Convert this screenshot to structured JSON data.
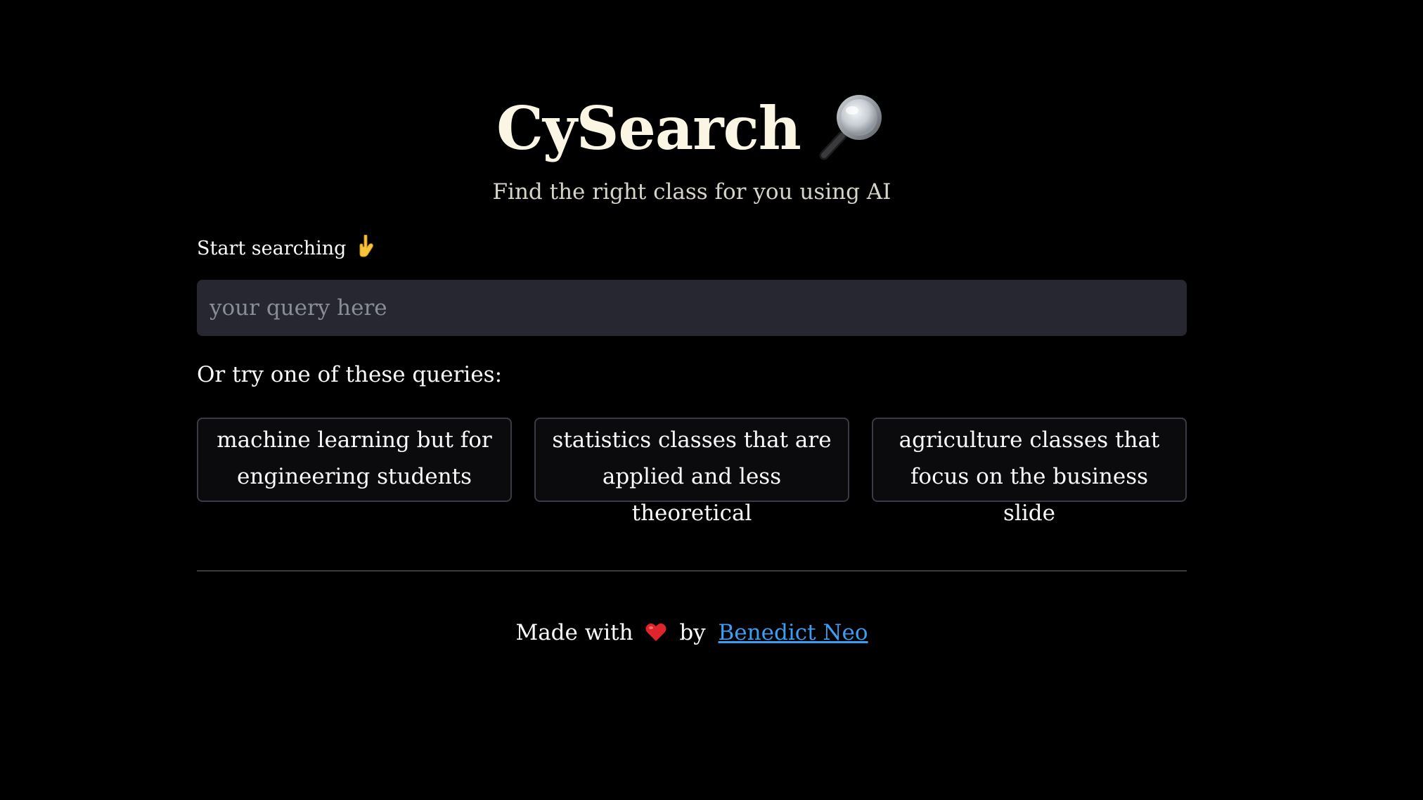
{
  "header": {
    "title": "CySearch",
    "title_icon": "magnifying-glass-icon",
    "subtitle": "Find the right class for you using AI"
  },
  "search": {
    "label": "Start searching",
    "label_icon": "pointing-down-icon",
    "placeholder": "your query here",
    "value": ""
  },
  "suggestions": {
    "label": "Or try one of these queries:",
    "items": [
      "machine learning but for engineering students",
      "statistics classes that are applied and less theoretical",
      "agriculture classes that focus on the business slide"
    ]
  },
  "footer": {
    "prefix": "Made with",
    "icon": "heart-icon",
    "middle": "by",
    "link_text": "Benedict Neo"
  },
  "colors": {
    "background": "#000000",
    "title": "#fbf6e3",
    "input_bg": "#262730",
    "link": "#3d9df3",
    "heart": "#e0242c"
  }
}
